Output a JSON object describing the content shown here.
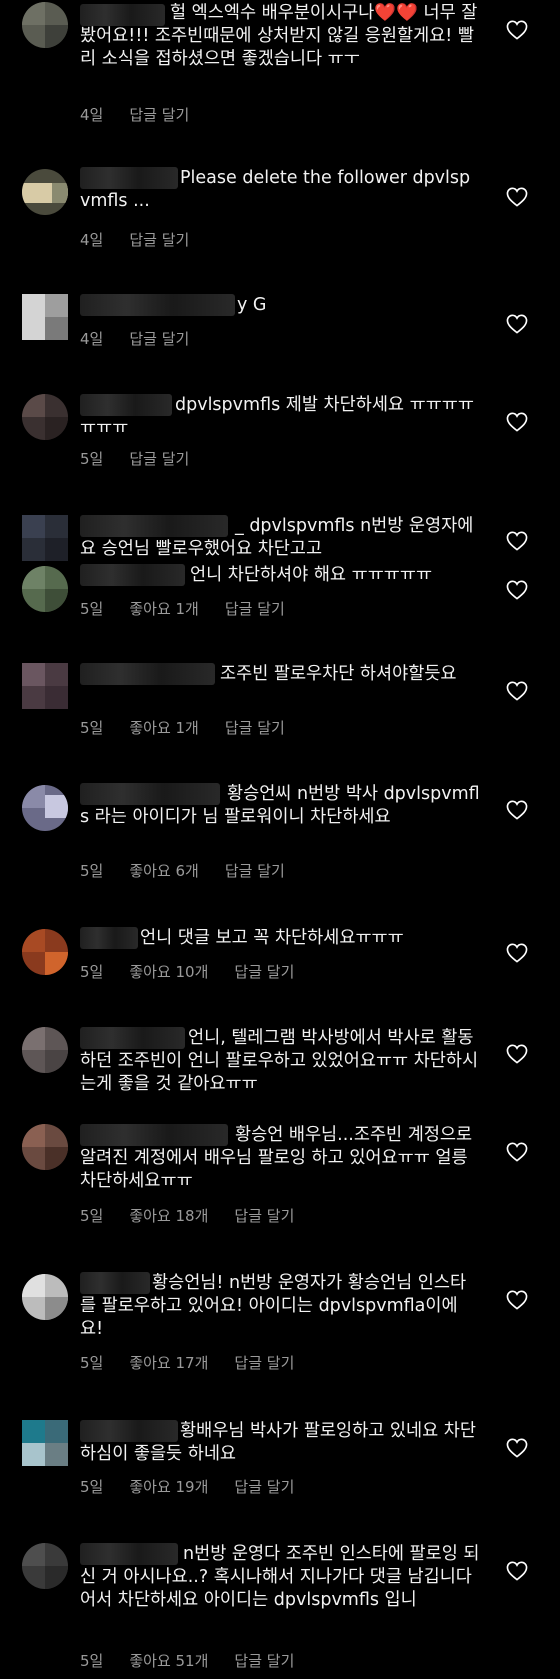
{
  "like_icon": "heart-outline-icon",
  "comments": [
    {
      "text": "헐 엑스엑수 배우분이시구나❤️❤️ 너무 잘봤어요!!! 조주빈때문에 상처받지 않길 응원할게요! 빨리 소식을 접하셨으면 좋겠습니다 ㅠㅜ",
      "time": "4일",
      "likes": "",
      "reply": "답글 달기"
    },
    {
      "text": "Please delete the follower dpvlspvmfls ...",
      "time": "4일",
      "likes": "",
      "reply": "답글 달기"
    },
    {
      "text": "y G",
      "time": "4일",
      "likes": "",
      "reply": "답글 달기"
    },
    {
      "text": "dpvlspvmfls 제발 차단하세요 ㅠㅠㅠㅠㅠㅠㅠ",
      "time": "5일",
      "likes": "",
      "reply": "답글 달기"
    },
    {
      "text": "_ dpvlspvmfls n번방 운영자에요 승언님 빨로우했어요 차단고고",
      "time": "",
      "likes": "",
      "reply": ""
    },
    {
      "text": "언니 차단하셔야 해요 ㅠㅠㅠㅠㅠ",
      "time": "5일",
      "likes": "좋아요 1개",
      "reply": "답글 달기"
    },
    {
      "text": "조주빈 팔로우차단 하셔야할듯요",
      "time": "5일",
      "likes": "좋아요 1개",
      "reply": "답글 달기"
    },
    {
      "text": "황승언씨 n번방 박사 dpvlspvmfls 라는 아이디가 님 팔로워이니 차단하세요",
      "time": "5일",
      "likes": "좋아요 6개",
      "reply": "답글 달기"
    },
    {
      "text": "언니 댓글 보고 꼭 차단하세요ㅠㅠㅠ",
      "time": "5일",
      "likes": "좋아요 10개",
      "reply": "답글 달기"
    },
    {
      "text": "언니, 텔레그램 박사방에서 박사로 활동하던 조주빈이 언니 팔로우하고 있었어요ㅠㅠ 차단하시는게 좋을 것 같아요ㅠㅠ",
      "time": "",
      "likes": "",
      "reply": ""
    },
    {
      "text": "황승언 배우님...조주빈 계정으로 알려진 계정에서 배우님 팔로잉 하고 있어요ㅠㅠ 얼릉 차단하세요ㅠㅠ",
      "time": "5일",
      "likes": "좋아요 18개",
      "reply": "답글 달기"
    },
    {
      "text": "황승언님! n번방 운영자가 황승언님 인스타를 팔로우하고 있어요! 아이디는 dpvlspvmfla이에요!",
      "time": "5일",
      "likes": "좋아요 17개",
      "reply": "답글 달기"
    },
    {
      "text": "황배우님 박사가 팔로잉하고 있네요 차단하심이 좋을듯 하네요",
      "time": "5일",
      "likes": "좋아요 19개",
      "reply": "답글 달기"
    },
    {
      "text": "n번방 운영다 조주빈 인스타에 팔로잉 되신 거 아시나요..? 혹시나해서 지나가다 댓글 남깁니다 어서 차단하세요 아이디는 dpvlspvmfls 입니",
      "time": "5일",
      "likes": "좋아요 51개",
      "reply": "답글 달기"
    }
  ]
}
